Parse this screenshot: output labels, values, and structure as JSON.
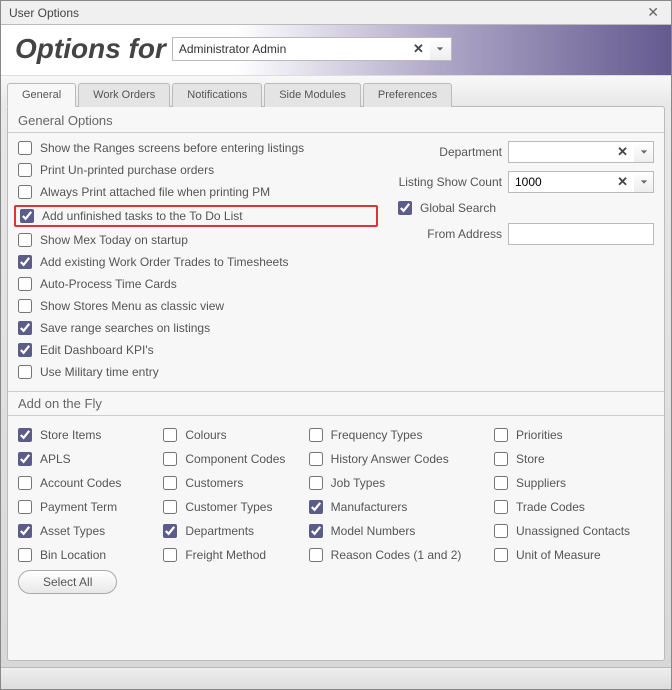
{
  "window": {
    "title": "User Options"
  },
  "header": {
    "label": "Options for",
    "user": "Administrator Admin"
  },
  "tabs": [
    "General",
    "Work Orders",
    "Notifications",
    "Side Modules",
    "Preferences"
  ],
  "active_tab": 0,
  "groups": {
    "general": "General Options",
    "fly": "Add on the Fly"
  },
  "general_left": [
    {
      "label": "Show the Ranges screens before entering listings",
      "checked": false
    },
    {
      "label": "Print Un-printed purchase orders",
      "checked": false
    },
    {
      "label": "Always Print attached file when printing PM",
      "checked": false
    },
    {
      "label": "Add unfinished tasks to the To Do List",
      "checked": true,
      "highlight": true
    },
    {
      "label": "Show Mex Today on startup",
      "checked": false
    },
    {
      "label": "Add existing Work Order Trades to Timesheets",
      "checked": true
    },
    {
      "label": "Auto-Process Time Cards",
      "checked": false
    },
    {
      "label": "Show Stores Menu as classic view",
      "checked": false
    },
    {
      "label": "Save range searches on listings",
      "checked": true
    },
    {
      "label": "Edit Dashboard KPI's",
      "checked": true
    },
    {
      "label": "Use Military time entry",
      "checked": false
    }
  ],
  "general_right": {
    "department": {
      "label": "Department",
      "value": ""
    },
    "listing_count": {
      "label": "Listing Show Count",
      "value": "1000"
    },
    "global_search": {
      "label": "Global Search",
      "checked": true
    },
    "from_address": {
      "label": "From Address",
      "value": ""
    }
  },
  "fly": [
    {
      "label": "Store Items",
      "checked": true
    },
    {
      "label": "Colours",
      "checked": false
    },
    {
      "label": "Frequency Types",
      "checked": false
    },
    {
      "label": "Priorities",
      "checked": false
    },
    {
      "label": "APLS",
      "checked": true
    },
    {
      "label": "Component Codes",
      "checked": false
    },
    {
      "label": "History Answer Codes",
      "checked": false
    },
    {
      "label": "Store",
      "checked": false
    },
    {
      "label": "Account Codes",
      "checked": false
    },
    {
      "label": "Customers",
      "checked": false
    },
    {
      "label": "Job Types",
      "checked": false
    },
    {
      "label": "Suppliers",
      "checked": false
    },
    {
      "label": "Payment Term",
      "checked": false
    },
    {
      "label": "Customer Types",
      "checked": false
    },
    {
      "label": "Manufacturers",
      "checked": true
    },
    {
      "label": "Trade Codes",
      "checked": false
    },
    {
      "label": "Asset Types",
      "checked": true
    },
    {
      "label": "Departments",
      "checked": true
    },
    {
      "label": "Model Numbers",
      "checked": true
    },
    {
      "label": "Unassigned Contacts",
      "checked": false
    },
    {
      "label": "Bin Location",
      "checked": false
    },
    {
      "label": "Freight Method",
      "checked": false
    },
    {
      "label": "Reason Codes (1 and 2)",
      "checked": false
    },
    {
      "label": "Unit of Measure",
      "checked": false
    }
  ],
  "buttons": {
    "select_all": "Select All"
  }
}
